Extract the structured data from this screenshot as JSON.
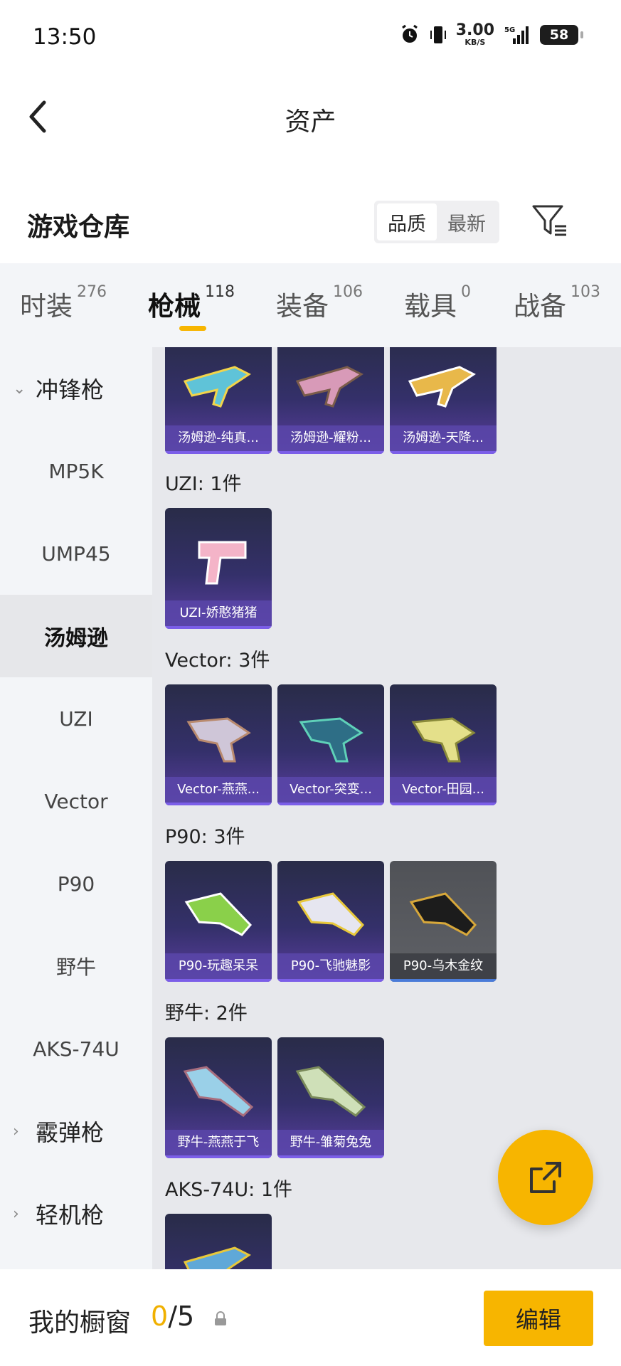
{
  "status_bar": {
    "time": "13:50",
    "speed_value": "3.00",
    "speed_unit": "KB/S",
    "network": "5G",
    "battery": "58"
  },
  "nav": {
    "title": "资产"
  },
  "section": {
    "title": "游戏仓库",
    "sort_options": [
      "品质",
      "最新"
    ],
    "sort_selected": "品质"
  },
  "tabs": [
    {
      "label": "时装",
      "count": "276"
    },
    {
      "label": "枪械",
      "count": "118"
    },
    {
      "label": "装备",
      "count": "106"
    },
    {
      "label": "载具",
      "count": "0"
    },
    {
      "label": "战备",
      "count": "103"
    }
  ],
  "active_tab": "枪械",
  "sidebar": {
    "group_open": "冲锋枪",
    "items": [
      "MP5K",
      "UMP45",
      "汤姆逊",
      "UZI",
      "Vector",
      "P90",
      "野牛",
      "AKS-74U"
    ],
    "selected": "汤姆逊",
    "groups_closed": [
      "霰弹枪",
      "轻机枪"
    ]
  },
  "groups": [
    {
      "label": "",
      "items": [
        "汤姆逊-纯真...",
        "汤姆逊-耀粉...",
        "汤姆逊-天降..."
      ]
    },
    {
      "label": "UZI: 1件",
      "items": [
        "UZI-娇憨猪猪"
      ]
    },
    {
      "label": "Vector: 3件",
      "items": [
        "Vector-燕燕...",
        "Vector-突变...",
        "Vector-田园..."
      ]
    },
    {
      "label": "P90: 3件",
      "items": [
        "P90-玩趣呆呆",
        "P90-飞驰魅影",
        "P90-乌木金纹"
      ]
    },
    {
      "label": "野牛: 2件",
      "items": [
        "野牛-燕燕于飞",
        "野牛-雏菊兔兔"
      ]
    },
    {
      "label": "AKS-74U: 1件",
      "items": [
        ""
      ]
    }
  ],
  "bottom": {
    "label": "我的橱窗",
    "count_current": "0",
    "count_sep_total": "/5",
    "edit_label": "编辑"
  },
  "icons": [
    "back-arrow-icon",
    "filter-icon",
    "share-icon",
    "lock-icon",
    "alarm-icon",
    "vibrate-icon",
    "signal-icon",
    "battery-icon"
  ],
  "colors": {
    "accent": "#f7b500",
    "card_purple": "#34306a",
    "card_gray": "#5f6166"
  }
}
